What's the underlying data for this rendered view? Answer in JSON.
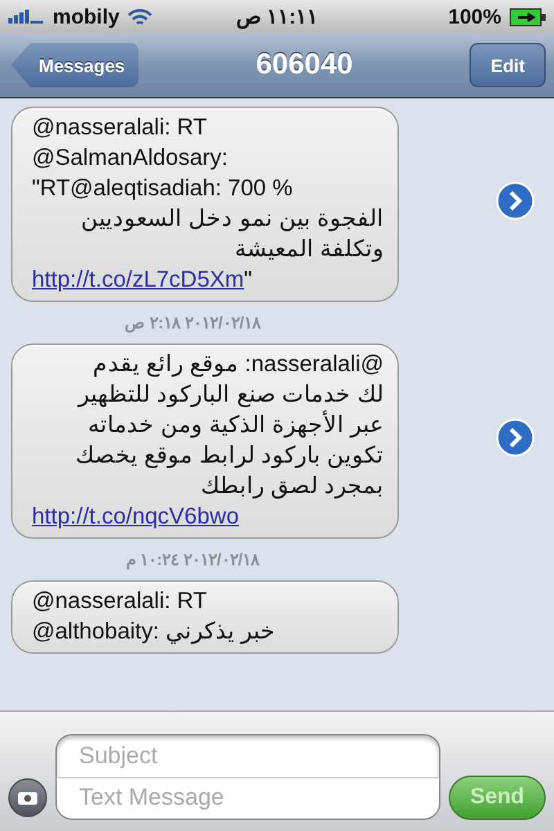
{
  "status_bar": {
    "carrier": "mobily",
    "time": "١١:١١ ص",
    "battery": "100%"
  },
  "nav_bar": {
    "back": "Messages",
    "title": "606040",
    "edit": "Edit"
  },
  "messages": [
    {
      "lines": [
        {
          "kind": "ltr",
          "text": "@nasseralali: RT"
        },
        {
          "kind": "ltr",
          "text": "@SalmanAldosary:"
        },
        {
          "kind": "ltr",
          "text": "\"RT@aleqtisadiah: 700 %"
        },
        {
          "kind": "rtl",
          "text": "الفجوة بين نمو دخل السعوديين"
        },
        {
          "kind": "rtl",
          "text": "وتكلفة المعيشة"
        },
        {
          "kind": "link",
          "text": "http://t.co/zL7cD5Xm",
          "after": "\""
        }
      ],
      "timestamp": "٢٠١٢/٠٢/١٨ ٢:١٨ ص"
    },
    {
      "lines": [
        {
          "kind": "rtl",
          "text": "@nasseralali: موقع رائع يقدم"
        },
        {
          "kind": "rtl",
          "text": "لك خدمات صنع الباركود للتظهير"
        },
        {
          "kind": "rtl",
          "text": "عبر الأجهزة الذكية ومن خدماته"
        },
        {
          "kind": "rtl",
          "text": "تكوين باركود لرابط موقع يخصك"
        },
        {
          "kind": "rtl",
          "text": "بمجرد لصق رابطك"
        },
        {
          "kind": "link",
          "text": "http://t.co/nqcV6bwo"
        }
      ],
      "timestamp": "٢٠١٢/٠٢/١٨ ١٠:٢٤ م"
    },
    {
      "lines": [
        {
          "kind": "ltr",
          "text": "@nasseralali: RT"
        },
        {
          "kind": "ltr",
          "text": "@althobaity: خبر يذكرني"
        }
      ]
    }
  ],
  "composer": {
    "subject_placeholder": "Subject",
    "message_placeholder": "Text Message",
    "send": "Send"
  }
}
